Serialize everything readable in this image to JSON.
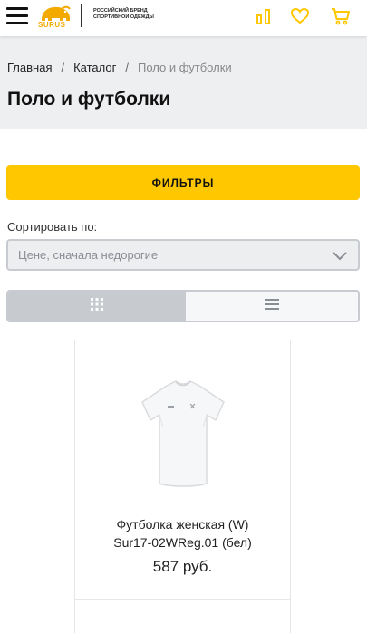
{
  "header": {
    "logo_word": "SURUS",
    "tagline_line1": "Российский бренд",
    "tagline_line2": "спортивной одежды",
    "icons": [
      "menu-icon",
      "compare-icon",
      "heart-icon",
      "cart-icon"
    ],
    "accent_color": "#fec700",
    "logo_color": "#f2a900"
  },
  "breadcrumb": {
    "items": [
      "Главная",
      "Каталог",
      "Поло и футболки"
    ],
    "separator": "/"
  },
  "page": {
    "title": "Поло и футболки"
  },
  "filters": {
    "button_label": "ФИЛЬТРЫ"
  },
  "sort": {
    "label": "Сортировать по:",
    "selected": "Цене, сначала недорогие"
  },
  "view_toggle": {
    "active": "grid",
    "options": [
      "grid",
      "list"
    ]
  },
  "products": [
    {
      "name_line1": "Футболка женская (W)",
      "name_line2": "Sur17-02WReg.01 (бел)",
      "price": "587 руб."
    }
  ]
}
